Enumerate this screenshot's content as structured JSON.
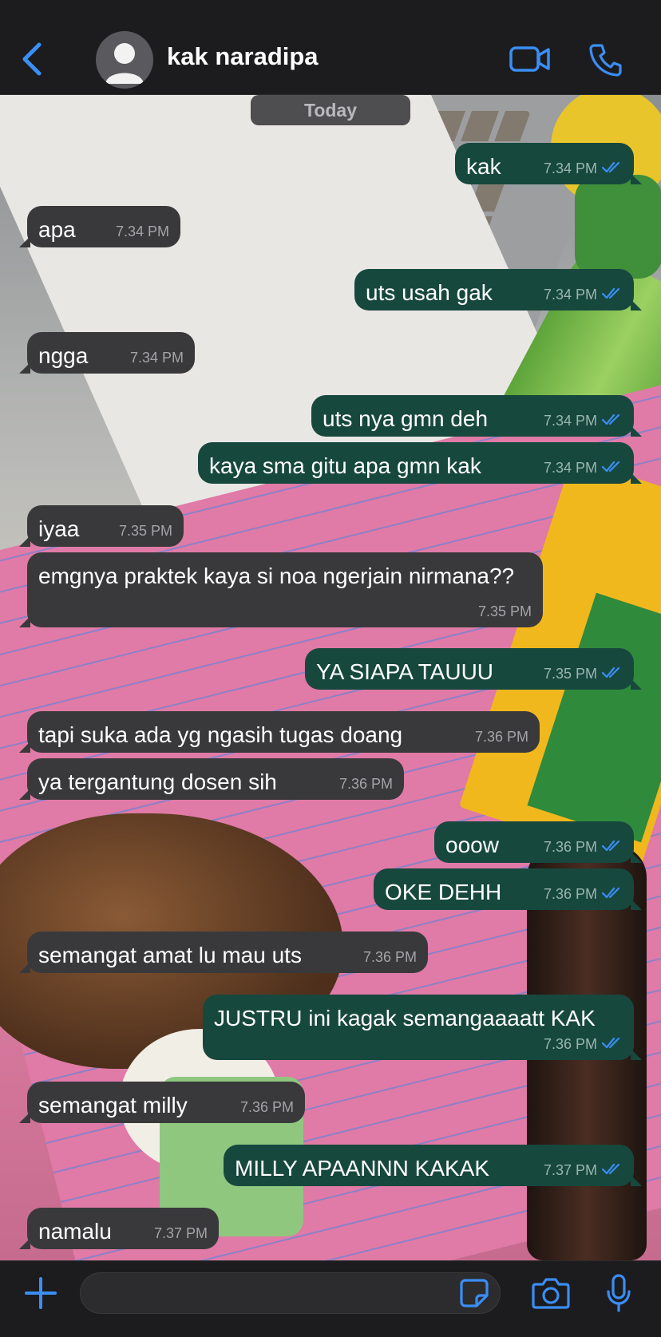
{
  "header": {
    "back_icon": "chevron-left-icon",
    "contact_name": "kak naradipa",
    "video_icon": "video-camera-icon",
    "phone_icon": "phone-icon"
  },
  "date_separator": "Today",
  "accent_color": "#3a8ef6",
  "incoming_color": "#39393b",
  "outgoing_color": "#17483e",
  "messages": [
    {
      "dir": "out",
      "text": "kak",
      "time": "7.34 PM",
      "read": true
    },
    {
      "dir": "in",
      "text": "apa",
      "time": "7.34 PM"
    },
    {
      "dir": "out",
      "text": "uts usah gak",
      "time": "7.34 PM",
      "read": true
    },
    {
      "dir": "in",
      "text": "ngga",
      "time": "7.34 PM"
    },
    {
      "dir": "out",
      "text": "uts nya gmn deh",
      "time": "7.34 PM",
      "read": true
    },
    {
      "dir": "out",
      "text": "kaya sma gitu apa gmn kak",
      "time": "7.34 PM",
      "read": true
    },
    {
      "dir": "in",
      "text": "iyaa",
      "time": "7.35 PM"
    },
    {
      "dir": "in",
      "text": "emgnya praktek kaya si noa ngerjain nirmana??",
      "time": "7.35 PM"
    },
    {
      "dir": "out",
      "text": "YA SIAPA TAUUU",
      "time": "7.35 PM",
      "read": true
    },
    {
      "dir": "in",
      "text": "tapi suka ada yg ngasih tugas doang",
      "time": "7.36 PM"
    },
    {
      "dir": "in",
      "text": "ya tergantung dosen sih",
      "time": "7.36 PM"
    },
    {
      "dir": "out",
      "text": "ooow",
      "time": "7.36 PM",
      "read": true
    },
    {
      "dir": "out",
      "text": "OKE DEHH",
      "time": "7.36 PM",
      "read": true
    },
    {
      "dir": "in",
      "text": "semangat amat lu mau uts",
      "time": "7.36 PM"
    },
    {
      "dir": "out",
      "text": "JUSTRU ini kagak semangaaaatt KAK",
      "time": "7.36 PM",
      "read": true
    },
    {
      "dir": "in",
      "text": "semangat milly",
      "time": "7.36 PM"
    },
    {
      "dir": "out",
      "text": "MILLY APAANNN KAKAK",
      "time": "7.37 PM",
      "read": true
    },
    {
      "dir": "in",
      "text": "namalu",
      "time": "7.37 PM"
    }
  ],
  "composer": {
    "plus_icon": "plus-icon",
    "input_value": "",
    "sticker_icon": "sticker-icon",
    "camera_icon": "camera-icon",
    "mic_icon": "microphone-icon"
  }
}
